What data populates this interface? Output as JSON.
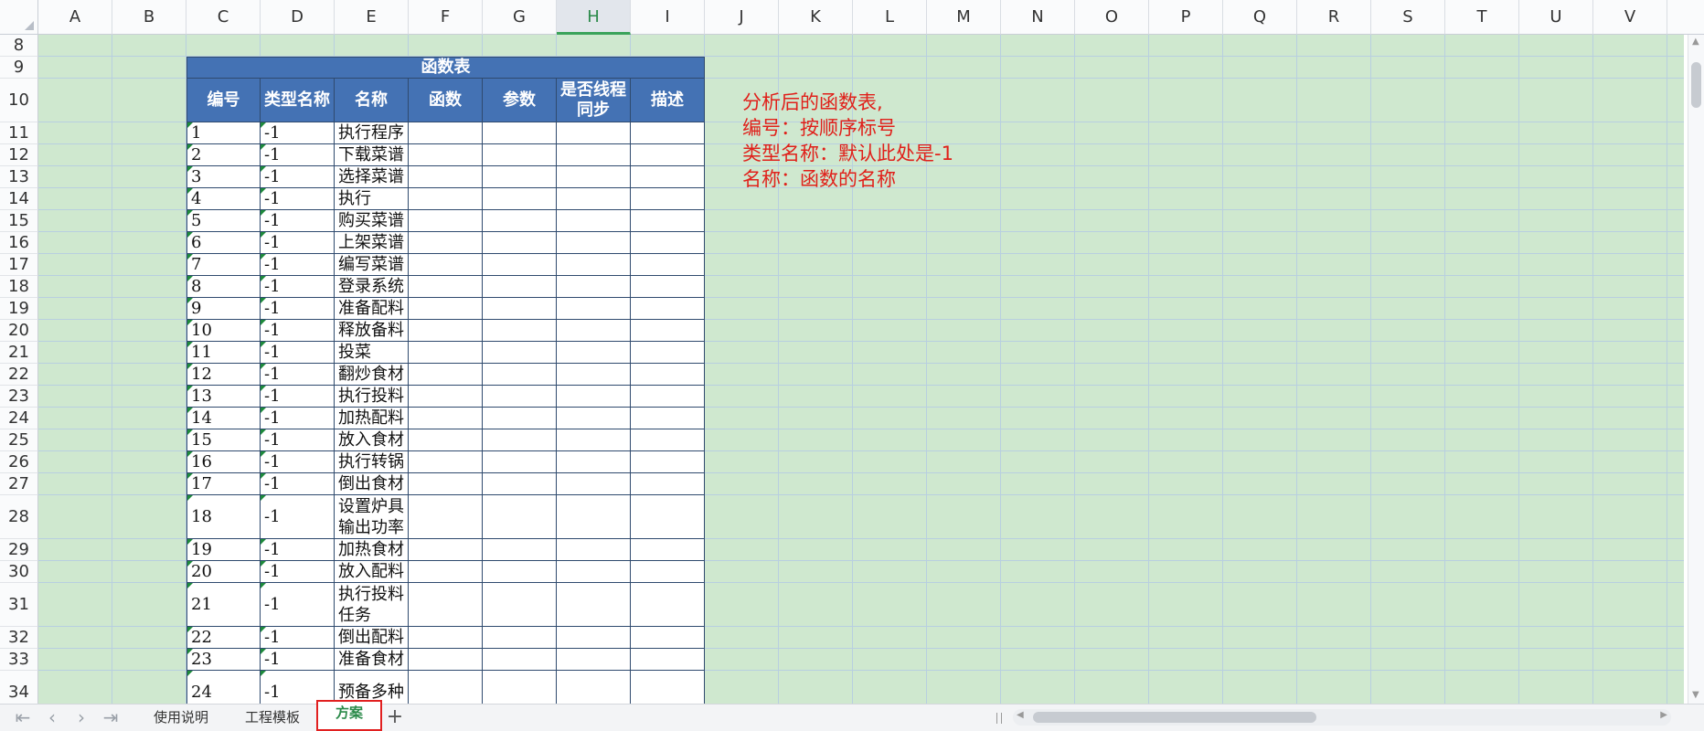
{
  "columns": [
    "A",
    "B",
    "C",
    "D",
    "E",
    "F",
    "G",
    "H",
    "I",
    "J",
    "K",
    "L",
    "M",
    "N",
    "O",
    "P",
    "Q",
    "R",
    "S",
    "T",
    "U",
    "V"
  ],
  "selected_column": "H",
  "rows": [
    "8",
    "9",
    "10",
    "11",
    "12",
    "13",
    "14",
    "15",
    "16",
    "17",
    "18",
    "19",
    "20",
    "21",
    "22",
    "23",
    "24",
    "25",
    "26",
    "27",
    "28",
    "29",
    "30",
    "31",
    "32",
    "33",
    "34"
  ],
  "table": {
    "title": "函数表",
    "headers": [
      "编号",
      "类型名称",
      "名称",
      "函数",
      "参数",
      "是否线程同步",
      "描述"
    ],
    "records": [
      {
        "id": "1",
        "type": "-1",
        "name": "执行程序"
      },
      {
        "id": "2",
        "type": "-1",
        "name": "下载菜谱"
      },
      {
        "id": "3",
        "type": "-1",
        "name": "选择菜谱"
      },
      {
        "id": "4",
        "type": "-1",
        "name": "执行"
      },
      {
        "id": "5",
        "type": "-1",
        "name": "购买菜谱"
      },
      {
        "id": "6",
        "type": "-1",
        "name": "上架菜谱"
      },
      {
        "id": "7",
        "type": "-1",
        "name": "编写菜谱"
      },
      {
        "id": "8",
        "type": "-1",
        "name": "登录系统"
      },
      {
        "id": "9",
        "type": "-1",
        "name": "准备配料"
      },
      {
        "id": "10",
        "type": "-1",
        "name": "释放备料"
      },
      {
        "id": "11",
        "type": "-1",
        "name": "投菜"
      },
      {
        "id": "12",
        "type": "-1",
        "name": "翻炒食材"
      },
      {
        "id": "13",
        "type": "-1",
        "name": "执行投料"
      },
      {
        "id": "14",
        "type": "-1",
        "name": "加热配料"
      },
      {
        "id": "15",
        "type": "-1",
        "name": "放入食材"
      },
      {
        "id": "16",
        "type": "-1",
        "name": "执行转锅"
      },
      {
        "id": "17",
        "type": "-1",
        "name": "倒出食材"
      },
      {
        "id": "18",
        "type": "-1",
        "name": "设置炉具输出功率"
      },
      {
        "id": "19",
        "type": "-1",
        "name": "加热食材"
      },
      {
        "id": "20",
        "type": "-1",
        "name": "放入配料"
      },
      {
        "id": "21",
        "type": "-1",
        "name": "执行投料任务"
      },
      {
        "id": "22",
        "type": "-1",
        "name": "倒出配料"
      },
      {
        "id": "23",
        "type": "-1",
        "name": "准备食材"
      },
      {
        "id": "24",
        "type": "-1",
        "name": "预备多种"
      }
    ]
  },
  "notes": [
    "分析后的函数表,",
    "编号：按顺序标号",
    "类型名称：默认此处是-1",
    "名称：函数的名称"
  ],
  "sheet_tabs": [
    {
      "label": "使用说明",
      "active": false
    },
    {
      "label": "工程模板",
      "active": false
    },
    {
      "label": "方案",
      "active": true
    }
  ],
  "add_sheet_label": "+",
  "icons": [
    "first-sheet-icon",
    "prev-sheet-icon",
    "next-sheet-icon",
    "last-sheet-icon",
    "add-sheet-icon",
    "select-all-icon"
  ],
  "colors": {
    "sheet_fill": "#cfe8cf",
    "header_fill": "#4472b4",
    "note_text": "#e0201a",
    "active_tab_border": "#e12020"
  }
}
